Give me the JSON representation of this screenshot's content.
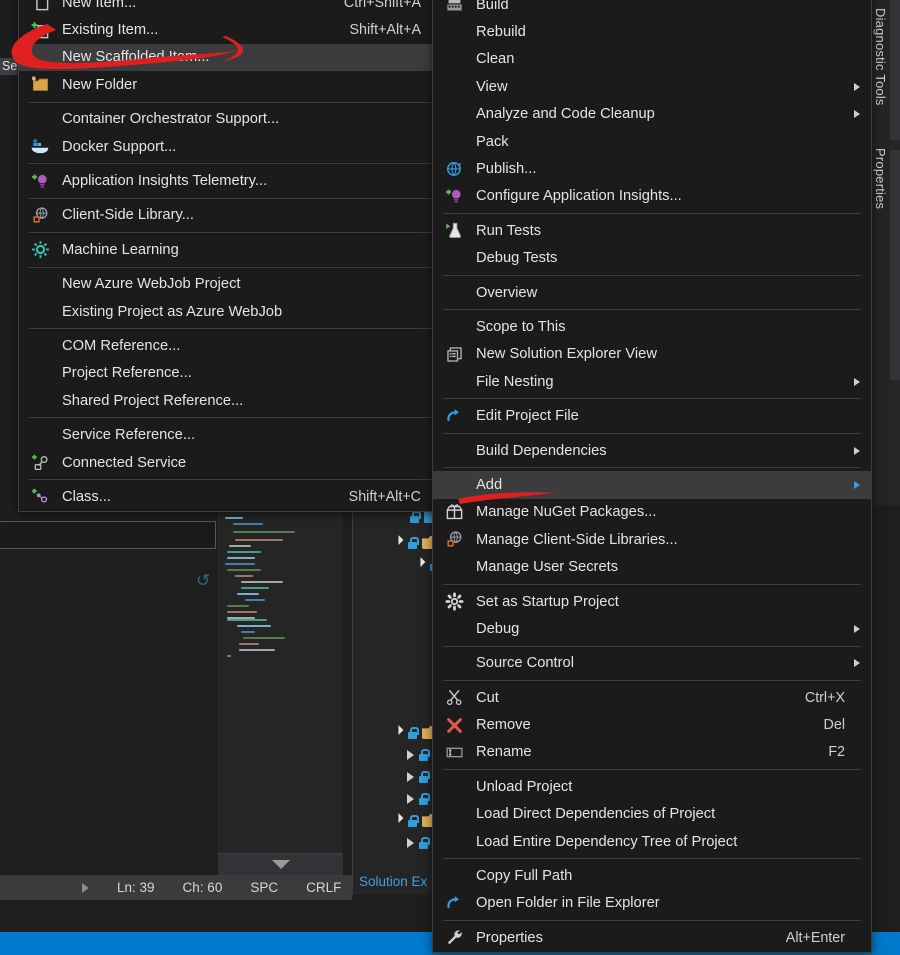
{
  "app": {
    "theme_bg": "#1e1e1e",
    "menu_bg": "#1b1b1c",
    "highlight": "#3c3c3e",
    "accent_blue": "#007acc",
    "marker_red": "#e02020"
  },
  "background": {
    "left_tab_chip": "Ser",
    "watermark_glyph": "↺",
    "solution_explorer_label": "Solution Ex",
    "status_bar": {
      "line_label": "Ln: 39",
      "char_label": "Ch: 60",
      "spaces_label": "SPC",
      "line_ending_label": "CRLF"
    },
    "tool_tabs": [
      {
        "label": "Diagnostic Tools"
      },
      {
        "label": "Properties"
      }
    ]
  },
  "add_submenu": {
    "title": "Add",
    "items": [
      {
        "label": "New Item...",
        "shortcut": "Ctrl+Shift+A",
        "icon": "new-item-icon",
        "selected": false,
        "submenu": false,
        "sep_after": false
      },
      {
        "label": "Existing Item...",
        "shortcut": "Shift+Alt+A",
        "icon": "existing-item-icon",
        "selected": false,
        "submenu": false,
        "sep_after": false
      },
      {
        "label": "New Scaffolded Item...",
        "shortcut": "",
        "icon": "",
        "selected": true,
        "submenu": false,
        "sep_after": false
      },
      {
        "label": "New Folder",
        "shortcut": "",
        "icon": "new-folder-icon",
        "selected": false,
        "submenu": false,
        "sep_after": true
      },
      {
        "label": "Container Orchestrator Support...",
        "shortcut": "",
        "icon": "",
        "selected": false,
        "submenu": false,
        "sep_after": false
      },
      {
        "label": "Docker Support...",
        "shortcut": "",
        "icon": "docker-icon",
        "selected": false,
        "submenu": false,
        "sep_after": true
      },
      {
        "label": "Application Insights Telemetry...",
        "shortcut": "",
        "icon": "app-insights-icon",
        "selected": false,
        "submenu": false,
        "sep_after": true
      },
      {
        "label": "Client-Side Library...",
        "shortcut": "",
        "icon": "client-side-library-icon",
        "selected": false,
        "submenu": false,
        "sep_after": true
      },
      {
        "label": "Machine Learning",
        "shortcut": "",
        "icon": "machine-learning-icon",
        "selected": false,
        "submenu": false,
        "sep_after": true
      },
      {
        "label": "New Azure WebJob Project",
        "shortcut": "",
        "icon": "",
        "selected": false,
        "submenu": false,
        "sep_after": false
      },
      {
        "label": "Existing Project as Azure WebJob",
        "shortcut": "",
        "icon": "",
        "selected": false,
        "submenu": false,
        "sep_after": true
      },
      {
        "label": "COM Reference...",
        "shortcut": "",
        "icon": "",
        "selected": false,
        "submenu": false,
        "sep_after": false
      },
      {
        "label": "Project Reference...",
        "shortcut": "",
        "icon": "",
        "selected": false,
        "submenu": false,
        "sep_after": false
      },
      {
        "label": "Shared Project Reference...",
        "shortcut": "",
        "icon": "",
        "selected": false,
        "submenu": false,
        "sep_after": true
      },
      {
        "label": "Service Reference...",
        "shortcut": "",
        "icon": "",
        "selected": false,
        "submenu": false,
        "sep_after": false
      },
      {
        "label": "Connected Service",
        "shortcut": "",
        "icon": "connected-service-icon",
        "selected": false,
        "submenu": false,
        "sep_after": true
      },
      {
        "label": "Class...",
        "shortcut": "Shift+Alt+C",
        "icon": "new-class-icon",
        "selected": false,
        "submenu": false,
        "sep_after": false
      }
    ]
  },
  "project_menu": {
    "items": [
      {
        "label": "Build",
        "shortcut": "",
        "icon": "build-icon",
        "selected": false,
        "submenu": false,
        "sep_after": false
      },
      {
        "label": "Rebuild",
        "shortcut": "",
        "icon": "",
        "selected": false,
        "submenu": false,
        "sep_after": false
      },
      {
        "label": "Clean",
        "shortcut": "",
        "icon": "",
        "selected": false,
        "submenu": false,
        "sep_after": false
      },
      {
        "label": "View",
        "shortcut": "",
        "icon": "",
        "selected": false,
        "submenu": true,
        "sep_after": false
      },
      {
        "label": "Analyze and Code Cleanup",
        "shortcut": "",
        "icon": "",
        "selected": false,
        "submenu": true,
        "sep_after": false
      },
      {
        "label": "Pack",
        "shortcut": "",
        "icon": "",
        "selected": false,
        "submenu": false,
        "sep_after": false
      },
      {
        "label": "Publish...",
        "shortcut": "",
        "icon": "publish-icon",
        "selected": false,
        "submenu": false,
        "sep_after": false
      },
      {
        "label": "Configure Application Insights...",
        "shortcut": "",
        "icon": "app-insights-icon",
        "selected": false,
        "submenu": false,
        "sep_after": true
      },
      {
        "label": "Run Tests",
        "shortcut": "",
        "icon": "run-tests-icon",
        "selected": false,
        "submenu": false,
        "sep_after": false
      },
      {
        "label": "Debug Tests",
        "shortcut": "",
        "icon": "",
        "selected": false,
        "submenu": false,
        "sep_after": true
      },
      {
        "label": "Overview",
        "shortcut": "",
        "icon": "",
        "selected": false,
        "submenu": false,
        "sep_after": true
      },
      {
        "label": "Scope to This",
        "shortcut": "",
        "icon": "",
        "selected": false,
        "submenu": false,
        "sep_after": false
      },
      {
        "label": "New Solution Explorer View",
        "shortcut": "",
        "icon": "solution-explorer-view-icon",
        "selected": false,
        "submenu": false,
        "sep_after": false
      },
      {
        "label": "File Nesting",
        "shortcut": "",
        "icon": "",
        "selected": false,
        "submenu": true,
        "sep_after": true
      },
      {
        "label": "Edit Project File",
        "shortcut": "",
        "icon": "edit-project-file-icon",
        "selected": false,
        "submenu": false,
        "sep_after": true
      },
      {
        "label": "Build Dependencies",
        "shortcut": "",
        "icon": "",
        "selected": false,
        "submenu": true,
        "sep_after": true
      },
      {
        "label": "Add",
        "shortcut": "",
        "icon": "",
        "selected": true,
        "submenu": true,
        "sep_after": false
      },
      {
        "label": "Manage NuGet Packages...",
        "shortcut": "",
        "icon": "nuget-icon",
        "selected": false,
        "submenu": false,
        "sep_after": false
      },
      {
        "label": "Manage Client-Side Libraries...",
        "shortcut": "",
        "icon": "client-side-library-icon",
        "selected": false,
        "submenu": false,
        "sep_after": false
      },
      {
        "label": "Manage User Secrets",
        "shortcut": "",
        "icon": "",
        "selected": false,
        "submenu": false,
        "sep_after": true
      },
      {
        "label": "Set as Startup Project",
        "shortcut": "",
        "icon": "gear-icon",
        "selected": false,
        "submenu": false,
        "sep_after": false
      },
      {
        "label": "Debug",
        "shortcut": "",
        "icon": "",
        "selected": false,
        "submenu": true,
        "sep_after": true
      },
      {
        "label": "Source Control",
        "shortcut": "",
        "icon": "",
        "selected": false,
        "submenu": true,
        "sep_after": true
      },
      {
        "label": "Cut",
        "shortcut": "Ctrl+X",
        "icon": "scissors-icon",
        "selected": false,
        "submenu": false,
        "sep_after": false
      },
      {
        "label": "Remove",
        "shortcut": "Del",
        "icon": "remove-x-icon",
        "selected": false,
        "submenu": false,
        "sep_after": false
      },
      {
        "label": "Rename",
        "shortcut": "F2",
        "icon": "rename-icon",
        "selected": false,
        "submenu": false,
        "sep_after": true
      },
      {
        "label": "Unload Project",
        "shortcut": "",
        "icon": "",
        "selected": false,
        "submenu": false,
        "sep_after": false
      },
      {
        "label": "Load Direct Dependencies of Project",
        "shortcut": "",
        "icon": "",
        "selected": false,
        "submenu": false,
        "sep_after": false
      },
      {
        "label": "Load Entire Dependency Tree of Project",
        "shortcut": "",
        "icon": "",
        "selected": false,
        "submenu": false,
        "sep_after": true
      },
      {
        "label": "Copy Full Path",
        "shortcut": "",
        "icon": "",
        "selected": false,
        "submenu": false,
        "sep_after": false
      },
      {
        "label": "Open Folder in File Explorer",
        "shortcut": "",
        "icon": "open-folder-icon",
        "selected": false,
        "submenu": false,
        "sep_after": true
      },
      {
        "label": "Properties",
        "shortcut": "Alt+Enter",
        "icon": "wrench-icon",
        "selected": false,
        "submenu": false,
        "sep_after": false
      }
    ]
  },
  "annotations": [
    {
      "name": "marker-new-scaffolded-item",
      "target": "New Scaffolded Item..."
    },
    {
      "name": "marker-add",
      "target": "Add"
    }
  ]
}
